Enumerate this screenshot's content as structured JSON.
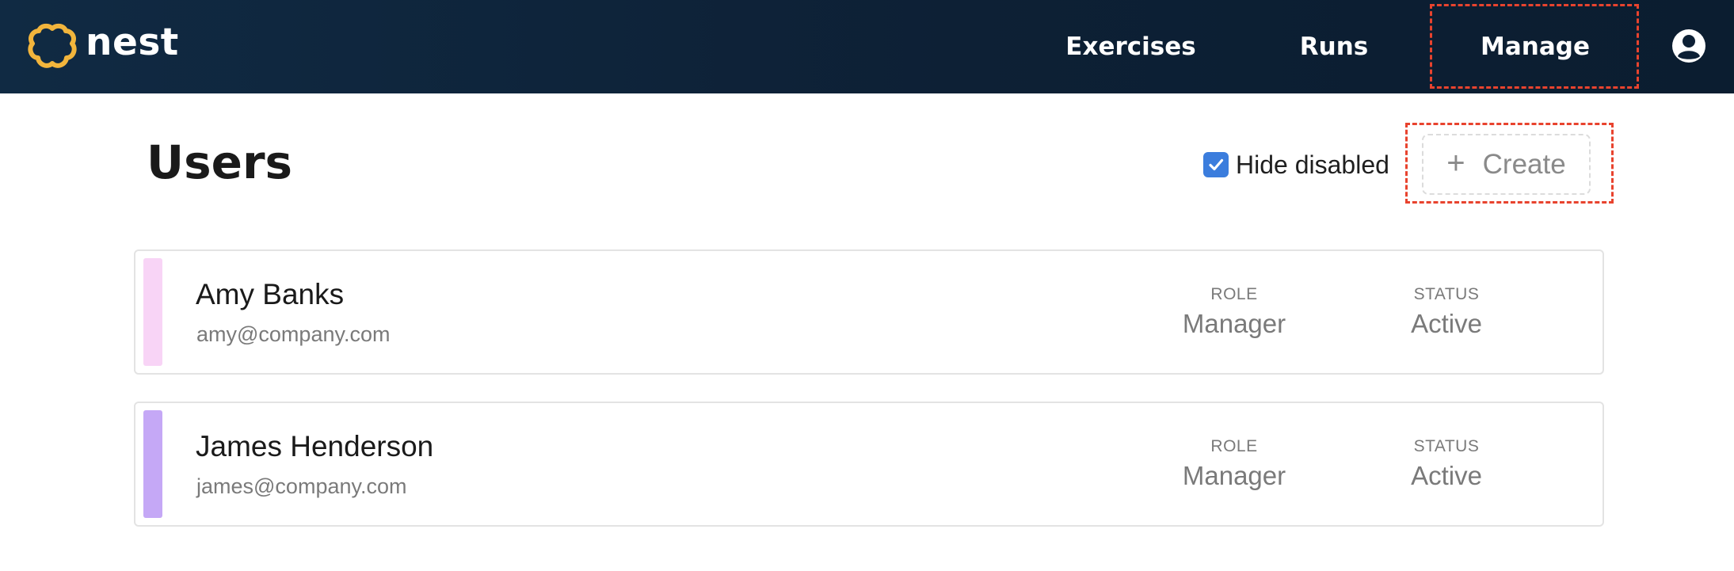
{
  "header": {
    "brand": "nest",
    "nav": [
      {
        "label": "Exercises"
      },
      {
        "label": "Runs"
      },
      {
        "label": "Manage"
      }
    ],
    "colors": {
      "background": "#0d2035",
      "logo": "#f2b53c",
      "highlight": "#e8432e"
    }
  },
  "page": {
    "title": "Users",
    "hide_disabled": {
      "label": "Hide disabled",
      "checked": true
    },
    "create_button": {
      "icon": "plus-icon",
      "label": "Create"
    }
  },
  "users": [
    {
      "name": "Amy Banks",
      "email": "amy@company.com",
      "role_label": "ROLE",
      "role": "Manager",
      "status_label": "STATUS",
      "status": "Active",
      "accent_color": "#f8d4f6"
    },
    {
      "name": "James Henderson",
      "email": "james@company.com",
      "role_label": "ROLE",
      "role": "Manager",
      "status_label": "STATUS",
      "status": "Active",
      "accent_color": "#c5a8f6"
    }
  ]
}
